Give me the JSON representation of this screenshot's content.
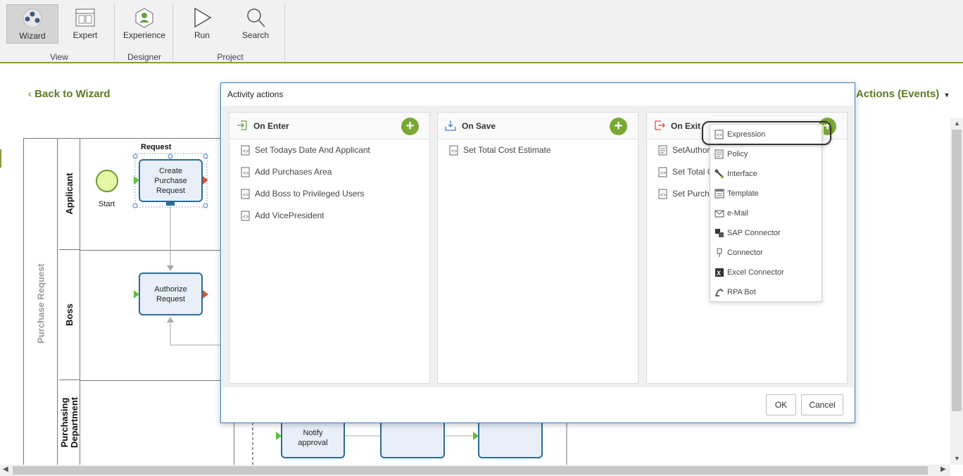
{
  "ribbon": {
    "buttons": [
      {
        "label": "Wizard",
        "icon": "wizard-icon",
        "active": true
      },
      {
        "label": "Expert",
        "icon": "expert-icon",
        "active": false
      },
      {
        "label": "Experience",
        "icon": "experience-icon",
        "active": false
      },
      {
        "label": "Run",
        "icon": "run-icon",
        "active": false
      },
      {
        "label": "Search",
        "icon": "search-icon",
        "active": false
      }
    ],
    "groups": {
      "view": "View",
      "designer": "Designer",
      "project": "Project"
    }
  },
  "nav": {
    "back_label": "Back to Wizard",
    "actions_label": "Actions (Events)"
  },
  "diagram": {
    "pool_label": "Purchase Request",
    "lanes": [
      "Applicant",
      "Boss",
      "Purchasing Department"
    ],
    "selected_label": "Request",
    "start_label": "Start",
    "tasks": [
      "Create Purchase Request",
      "Authorize Request",
      "Notify approval"
    ]
  },
  "dialog": {
    "title": "Activity actions",
    "columns": [
      {
        "title": "On Enter",
        "icon": "enter-icon",
        "items": [
          "Set Todays Date And Applicant",
          "Add Purchases Area",
          "Add Boss to Privileged Users",
          "Add VicePresident"
        ]
      },
      {
        "title": "On Save",
        "icon": "save-icon",
        "items": [
          "Set Total Cost Estimate"
        ]
      },
      {
        "title": "On Exit",
        "icon": "exit-icon",
        "items": [
          "SetAuthori",
          "Set Total Co",
          "Set Purchas"
        ]
      }
    ],
    "ok_label": "OK",
    "cancel_label": "Cancel"
  },
  "dropdown": {
    "items": [
      {
        "label": "Expression",
        "icon": "expression-icon"
      },
      {
        "label": "Policy",
        "icon": "policy-icon"
      },
      {
        "label": "Interface",
        "icon": "interface-icon"
      },
      {
        "label": "Template",
        "icon": "template-icon"
      },
      {
        "label": "e-Mail",
        "icon": "email-icon"
      },
      {
        "label": "SAP Connector",
        "icon": "sap-connector-icon"
      },
      {
        "label": "Connector",
        "icon": "connector-icon"
      },
      {
        "label": "Excel Connector",
        "icon": "excel-connector-icon"
      },
      {
        "label": "RPA Bot",
        "icon": "rpa-bot-icon"
      }
    ],
    "highlighted": "Expression"
  },
  "colors": {
    "accent": "#7aa833",
    "link": "#5d7a23",
    "task_border": "#2b6c9a",
    "dialog_border": "#3d7fc8"
  }
}
